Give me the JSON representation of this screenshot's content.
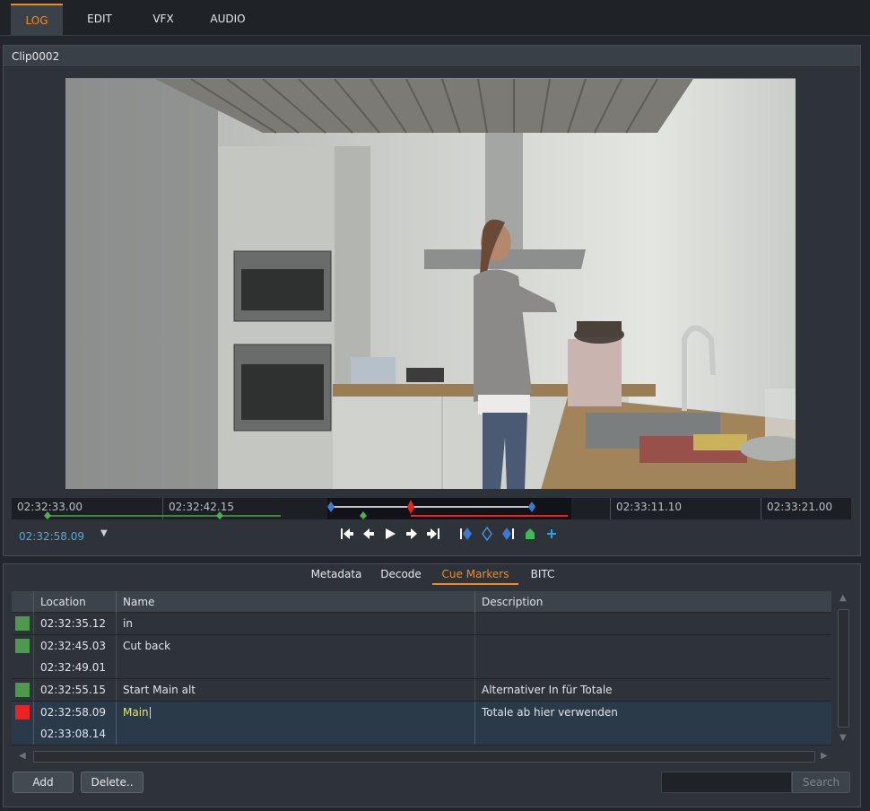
{
  "tabs": [
    {
      "label": "LOG",
      "active": true
    },
    {
      "label": "EDIT",
      "active": false
    },
    {
      "label": "VFX",
      "active": false
    },
    {
      "label": "AUDIO",
      "active": false
    }
  ],
  "viewer": {
    "clip_name": "Clip0002",
    "timeline_labels": [
      "02:32:33.00",
      "02:32:42.15",
      "02:33:11.10",
      "02:33:21.00"
    ],
    "current_timecode": "02:32:58.09",
    "dropdown_glyph": "▼"
  },
  "transport": [
    {
      "icon": "go-to-start-icon",
      "glyph": "|←"
    },
    {
      "icon": "step-back-icon",
      "glyph": "←"
    },
    {
      "icon": "play-icon",
      "glyph": "▶"
    },
    {
      "icon": "step-forward-icon",
      "glyph": "→"
    },
    {
      "icon": "go-to-end-icon",
      "glyph": "→|"
    },
    {
      "icon": "set-in-marker-icon",
      "glyph": "◆"
    },
    {
      "icon": "marker-icon",
      "glyph": "◇"
    },
    {
      "icon": "set-out-marker-icon",
      "glyph": "◆"
    },
    {
      "icon": "cue-marker-icon",
      "glyph": "⌂"
    },
    {
      "icon": "add-marker-icon",
      "glyph": "+"
    }
  ],
  "bottom_tabs": [
    {
      "label": "Metadata",
      "active": false
    },
    {
      "label": "Decode",
      "active": false
    },
    {
      "label": "Cue Markers",
      "active": true
    },
    {
      "label": "BITC",
      "active": false
    }
  ],
  "table": {
    "headers": [
      "Location",
      "Name",
      "Description"
    ],
    "rows": [
      {
        "color": "#4c9a4c",
        "location": "02:32:35.12",
        "name": "in",
        "description": ""
      },
      {
        "color": "#4c9a4c",
        "location": "02:32:45.03",
        "name": "Cut back",
        "description": "",
        "end_location": "02:32:49.01"
      },
      {
        "color": "#4c9a4c",
        "location": "02:32:55.15",
        "name": "Start Main alt",
        "description": "Alternativer In für Totale"
      },
      {
        "color": "#ee2222",
        "location": "02:32:58.09",
        "name": "Main",
        "description": "Totale ab hier verwenden",
        "end_location": "02:33:08.14"
      }
    ]
  },
  "buttons": {
    "add": "Add",
    "delete": "Delete..",
    "search": "Search",
    "search_value": ""
  },
  "colors": {
    "accent": "#f08a24",
    "timecode": "#5aa6d8",
    "marker_green": "#4c9a4c",
    "marker_red": "#ee2222",
    "marker_blue": "#3a7bd5"
  }
}
